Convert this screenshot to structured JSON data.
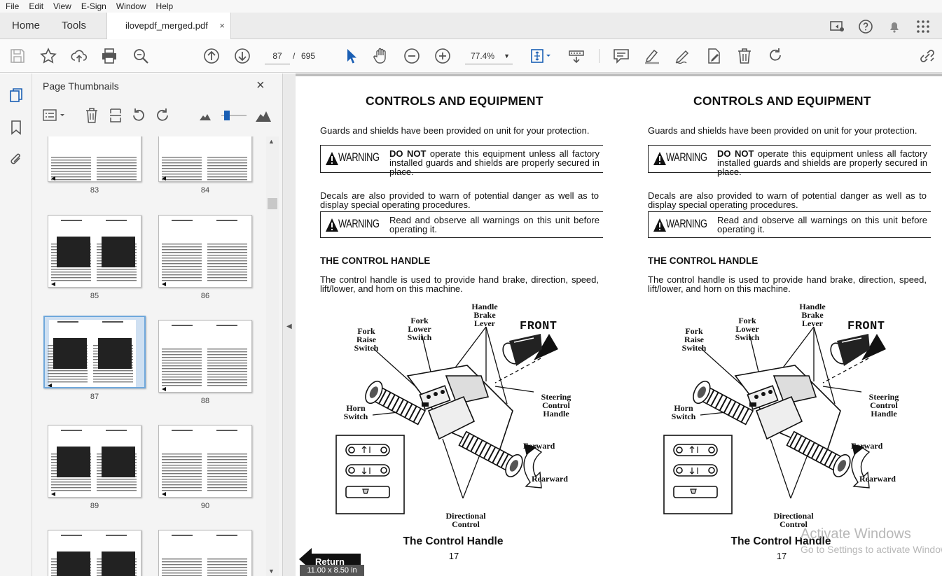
{
  "menu": [
    "File",
    "Edit",
    "View",
    "E-Sign",
    "Window",
    "Help"
  ],
  "tabs": {
    "home": "Home",
    "tools": "Tools",
    "document": "ilovepdf_merged.pdf",
    "close": "×"
  },
  "toolbar": {
    "current_page": "87",
    "page_sep": "/",
    "total_pages": "695",
    "zoom": "77.4%"
  },
  "sidebar": {
    "title": "Page Thumbnails",
    "close": "×",
    "thumbnails": [
      {
        "label": "83"
      },
      {
        "label": "84"
      },
      {
        "label": "85"
      },
      {
        "label": "86"
      },
      {
        "label": "87",
        "selected": true
      },
      {
        "label": "88"
      },
      {
        "label": "89"
      },
      {
        "label": "90"
      },
      {
        "label": ""
      },
      {
        "label": ""
      }
    ]
  },
  "pages": [
    {
      "title": "CONTROLS AND EQUIPMENT",
      "intro": "Guards and shields have been provided on unit for your protection.",
      "warning1_bold": "DO NOT",
      "warning1_text": " operate this equipment unless all factory installed guards and shields are properly secured in place.",
      "decals": "Decals are also provided to warn of potential danger as well as to display special operating procedures.",
      "warning2_text": "Read and observe all warnings on this unit before operating it.",
      "warning_label": "WARNING",
      "section": "THE CONTROL HANDLE",
      "section_text": "The control handle is used to provide hand brake,  direction, speed, lift/lower, and horn on this machine.",
      "figure_labels": {
        "handle_brake": [
          "Handle",
          "Brake",
          "Lever"
        ],
        "fork_lower": [
          "Fork",
          "Lower",
          "Switch"
        ],
        "fork_raise": [
          "Fork",
          "Raise",
          "Switch"
        ],
        "front": "FRONT",
        "steering": [
          "Steering",
          "Control",
          "Handle"
        ],
        "horn": [
          "Horn",
          "Switch"
        ],
        "forward": "Forward",
        "rearward": "Rearward",
        "directional": [
          "Directional",
          "Control"
        ]
      },
      "caption": "The Control Handle",
      "page_number": "17"
    },
    {
      "title": "CONTROLS AND EQUIPMENT",
      "intro": "Guards and shields have been provided on unit for your protection.",
      "warning1_bold": "DO NOT",
      "warning1_text": " operate this equipment unless all factory installed guards and shields are properly secured in place.",
      "decals": "Decals are also provided to warn of potential danger as well as to display special operating procedures.",
      "warning2_text": "Read and observe all warnings on this unit before operating it.",
      "warning_label": "WARNING",
      "section": "THE CONTROL HANDLE",
      "section_text": "The control handle is used to provide hand brake,  direction, speed, lift/lower, and horn on this machine.",
      "figure_labels": {
        "handle_brake": [
          "Handle",
          "Brake",
          "Lever"
        ],
        "fork_lower": [
          "Fork",
          "Lower",
          "Switch"
        ],
        "fork_raise": [
          "Fork",
          "Raise",
          "Switch"
        ],
        "front": "FRONT",
        "steering": [
          "Steering",
          "Control",
          "Handle"
        ],
        "horn": [
          "Horn",
          "Switch"
        ],
        "forward": "Forward",
        "rearward": "Rearward",
        "directional": [
          "Directional",
          "Control"
        ]
      },
      "caption": "The Control Handle",
      "page_number": "17"
    }
  ],
  "overlay": {
    "return_label": "Return",
    "page_size": "11.00 x 8.50 in",
    "activate_title": "Activate Windows",
    "activate_sub": "Go to Settings to activate Windows."
  }
}
